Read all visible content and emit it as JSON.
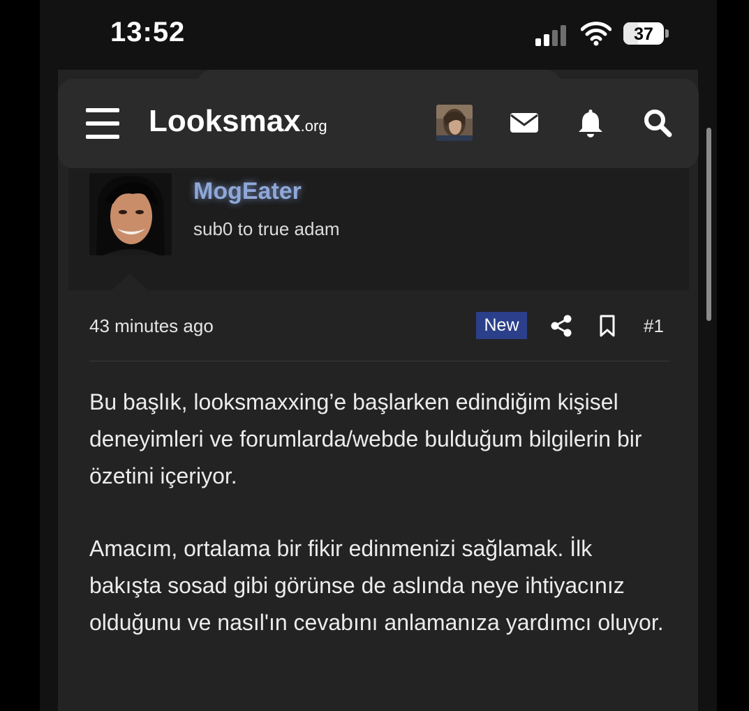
{
  "status_bar": {
    "time": "13:52",
    "battery": "37",
    "battery_level": 0.37
  },
  "navbar": {
    "logo_main": "Looksmax",
    "logo_tld": ".org",
    "icons": [
      "menu-icon",
      "avatar",
      "envelope-icon",
      "bell-icon",
      "search-icon"
    ]
  },
  "post": {
    "author": "MogEater",
    "author_title": "sub0 to true adam",
    "time": "43 minutes ago",
    "badge": "New",
    "number": "#1",
    "paragraphs": [
      "Bu başlık, looksmaxxing’e başlarken edindiğim kişisel deneyimleri ve forumlarda/webde bulduğum bilgilerin bir özetini içeriyor.",
      "Amacım, ortalama bir fikir edinmenizi sağlamak. İlk bakışta sosad gibi görünse de aslında neye ihtiyacınız olduğunu ve nasıl'ın cevabını anlamanıza yardımcı oluyor."
    ]
  },
  "colors": {
    "username": "#8fa8d8",
    "badge_bg": "#2b3f8a",
    "page_bg": "#232323"
  }
}
